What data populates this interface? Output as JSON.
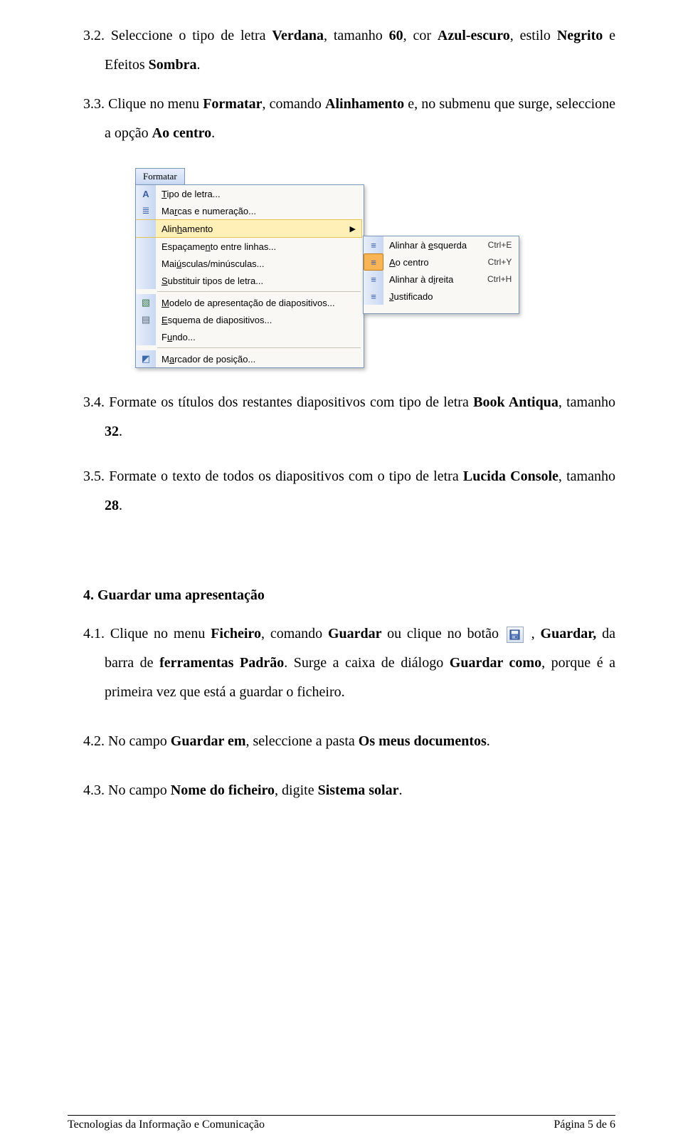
{
  "p32_a": "3.2. Seleccione o tipo de letra ",
  "p32_b": "Verdana",
  "p32_c": ", tamanho ",
  "p32_d": "60",
  "p32_e": ", cor ",
  "p32_f": "Azul-escuro",
  "p32_g": ", estilo ",
  "p32_h": "Negrito",
  "p32_i": " e Efeitos ",
  "p32_j": "Sombra",
  "p32_k": ".",
  "p33_a": "3.3. Clique no menu ",
  "p33_b": "Formatar",
  "p33_c": ", comando ",
  "p33_d": "Alinhamento",
  "p33_e": " e, no submenu que surge, seleccione a opção ",
  "p33_f": "Ao centro",
  "p33_g": ".",
  "menu": {
    "tab": "Formatar",
    "items": {
      "i0": "Tipo de letra...",
      "i1": "Marcas e numeração...",
      "i2": "Alinhamento",
      "i3": "Espaçamento entre linhas...",
      "i4": "Maiúsculas/minúsculas...",
      "i5": "Substituir tipos de letra...",
      "i6": "Modelo de apresentação de diapositivos...",
      "i7": "Esquema de diapositivos...",
      "i8": "Fundo...",
      "i9": "Marcador de posição..."
    },
    "sub": {
      "s0": {
        "label": "Alinhar à esquerda",
        "shortcut": "Ctrl+E"
      },
      "s1": {
        "label": "Ao centro",
        "shortcut": "Ctrl+Y"
      },
      "s2": {
        "label": "Alinhar à direita",
        "shortcut": "Ctrl+H"
      },
      "s3": {
        "label": "Justificado",
        "shortcut": ""
      }
    }
  },
  "p34_a": "3.4. Formate os títulos dos restantes diapositivos com tipo de letra ",
  "p34_b": "Book Antiqua",
  "p34_c": ", tamanho ",
  "p34_d": "32",
  "p34_e": ".",
  "p35_a": "3.5.  Formate o texto de todos os diapositivos com o tipo de letra ",
  "p35_b": "Lucida Console",
  "p35_c": ", tamanho ",
  "p35_d": "28",
  "p35_e": ".",
  "h4": "4.  Guardar uma apresentação",
  "p41_a": "4.1. Clique no menu ",
  "p41_b": "Ficheiro",
  "p41_c": ", comando ",
  "p41_d": "Guardar ",
  "p41_e": " ou clique  no  botão ",
  "p41_f": " , ",
  "p41_g": "Guardar, ",
  "p41_h": " da barra de ",
  "p41_i": "ferramentas Padrão",
  "p41_j": ". Surge a caixa de diálogo ",
  "p41_k": "Guardar como",
  "p41_l": ", porque é a primeira vez que está a guardar o ficheiro.",
  "p42_a": "4.2. No campo ",
  "p42_b": "Guardar em",
  "p42_c": ", seleccione a pasta ",
  "p42_d": "Os meus documentos",
  "p42_e": ".",
  "p43_a": "4.3. No campo ",
  "p43_b": "Nome do ficheiro",
  "p43_c": ", digite ",
  "p43_d": "Sistema solar",
  "p43_e": ".",
  "footer": {
    "left": "Tecnologias da Informação e Comunicação",
    "right": "Página 5 de 6"
  }
}
